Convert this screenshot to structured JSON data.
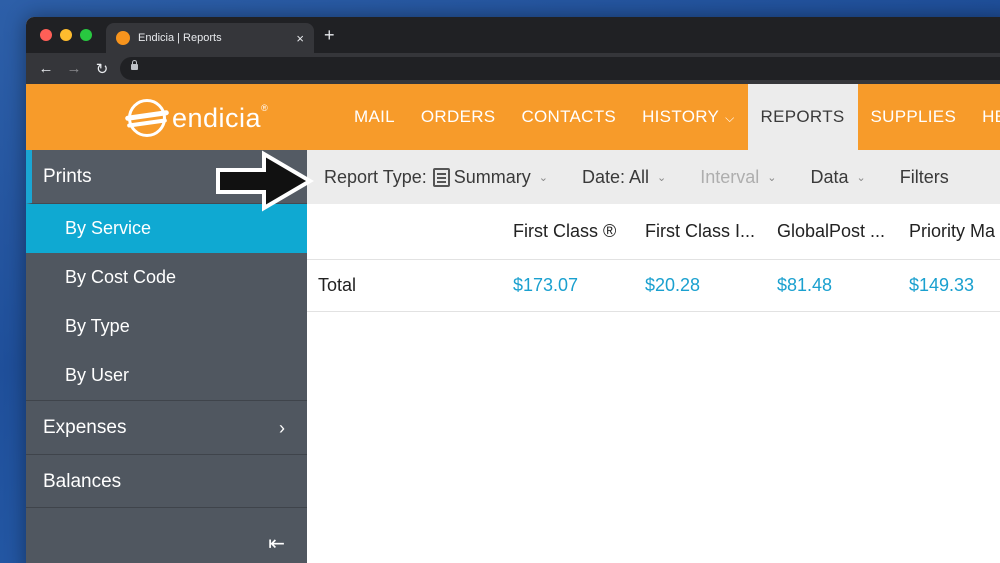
{
  "browser": {
    "tab_title": "Endicia | Reports",
    "tab_close": "×",
    "new_tab": "+",
    "back": "←",
    "forward": "→",
    "reload": "↻"
  },
  "header": {
    "logo_text": "endicia",
    "logo_mark": "®",
    "nav": [
      {
        "label": "MAIL"
      },
      {
        "label": "ORDERS"
      },
      {
        "label": "CONTACTS"
      },
      {
        "label": "HISTORY"
      },
      {
        "label": "REPORTS"
      },
      {
        "label": "SUPPLIES"
      },
      {
        "label": "HELP"
      }
    ]
  },
  "sidebar": {
    "section": "Prints",
    "sub_items": [
      {
        "label": "By Service"
      },
      {
        "label": "By Cost Code"
      },
      {
        "label": "By Type"
      },
      {
        "label": "By User"
      }
    ],
    "expenses": "Expenses",
    "expenses_arrow": "›",
    "balances": "Balances",
    "collapse": "⇤"
  },
  "filters": {
    "report_type_label": "Report Type:",
    "report_type_value": "Summary",
    "date": "Date: All",
    "interval": "Interval",
    "data": "Data",
    "filters": "Filters",
    "chevron": "⌄"
  },
  "table": {
    "columns": [
      "First Class ®",
      "First Class I...",
      "GlobalPost ...",
      "Priority Ma"
    ],
    "rows": [
      {
        "label": "Total",
        "values": [
          "$173.07",
          "$20.28",
          "$81.48",
          "$149.33"
        ]
      }
    ]
  }
}
